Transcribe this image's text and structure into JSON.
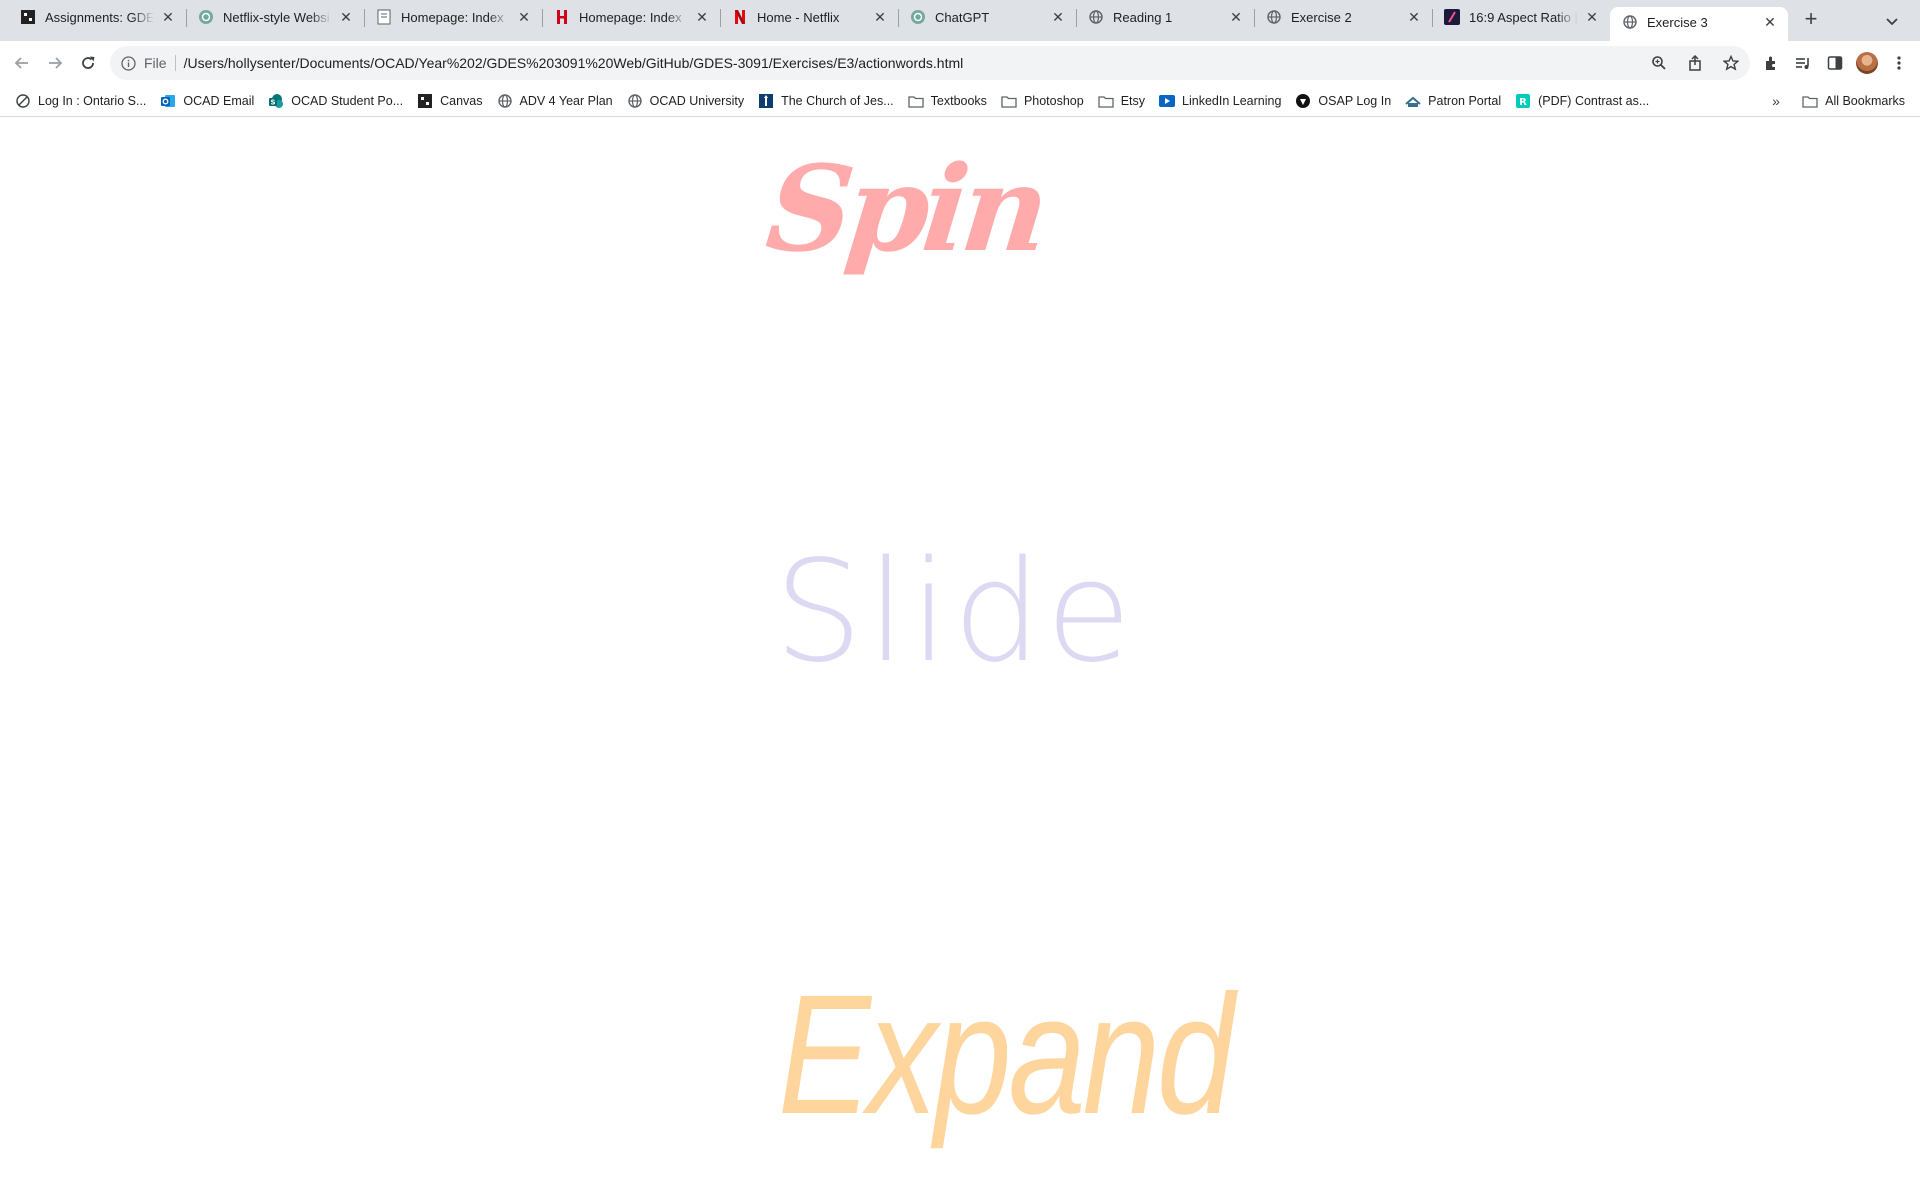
{
  "tabs": [
    {
      "title": "Assignments: GDES",
      "icon": "canvas-icon",
      "active": false
    },
    {
      "title": "Netflix-style Websi",
      "icon": "chatgpt-icon",
      "active": false
    },
    {
      "title": "Homepage: Index",
      "icon": "document-icon",
      "active": false
    },
    {
      "title": "Homepage: Index",
      "icon": "h-logo-icon",
      "active": false
    },
    {
      "title": "Home - Netflix",
      "icon": "netflix-icon",
      "active": false
    },
    {
      "title": "ChatGPT",
      "icon": "chatgpt-icon",
      "active": false
    },
    {
      "title": "Reading 1",
      "icon": "globe-icon",
      "active": false
    },
    {
      "title": "Exercise 2",
      "icon": "globe-icon",
      "active": false
    },
    {
      "title": "16:9 Aspect Ratio |",
      "icon": "slash-logo-icon",
      "active": false
    },
    {
      "title": "Exercise 3",
      "icon": "globe-icon",
      "active": true
    }
  ],
  "address_bar": {
    "scheme_label": "File",
    "url": "/Users/hollysenter/Documents/OCAD/Year%202/GDES%203091%20Web/GitHub/GDES-3091/Exercises/E3/actionwords.html"
  },
  "bookmarks": [
    {
      "label": "Log In : Ontario S...",
      "icon": "link-icon"
    },
    {
      "label": "OCAD Email",
      "icon": "outlook-icon"
    },
    {
      "label": "OCAD Student Po...",
      "icon": "sharepoint-icon"
    },
    {
      "label": "Canvas",
      "icon": "canvas-icon"
    },
    {
      "label": "ADV 4 Year Plan",
      "icon": "globe-icon"
    },
    {
      "label": "OCAD University",
      "icon": "globe-icon"
    },
    {
      "label": "The Church of Jes...",
      "icon": "church-icon"
    },
    {
      "label": "Textbooks",
      "icon": "folder-icon"
    },
    {
      "label": "Photoshop",
      "icon": "folder-icon"
    },
    {
      "label": "Etsy",
      "icon": "folder-icon"
    },
    {
      "label": "LinkedIn Learning",
      "icon": "linkedin-learning-icon"
    },
    {
      "label": "OSAP Log In",
      "icon": "osap-icon"
    },
    {
      "label": "Patron Portal",
      "icon": "patron-icon"
    },
    {
      "label": "(PDF) Contrast as...",
      "icon": "researchgate-icon"
    }
  ],
  "all_bookmarks_label": "All Bookmarks",
  "content": {
    "word_spin": "Spin",
    "word_slide": "Slide",
    "word_expand": "Expand"
  },
  "colors": {
    "spin": "#ffabab",
    "slide": "#ded9f2",
    "expand": "#ffd59e"
  }
}
